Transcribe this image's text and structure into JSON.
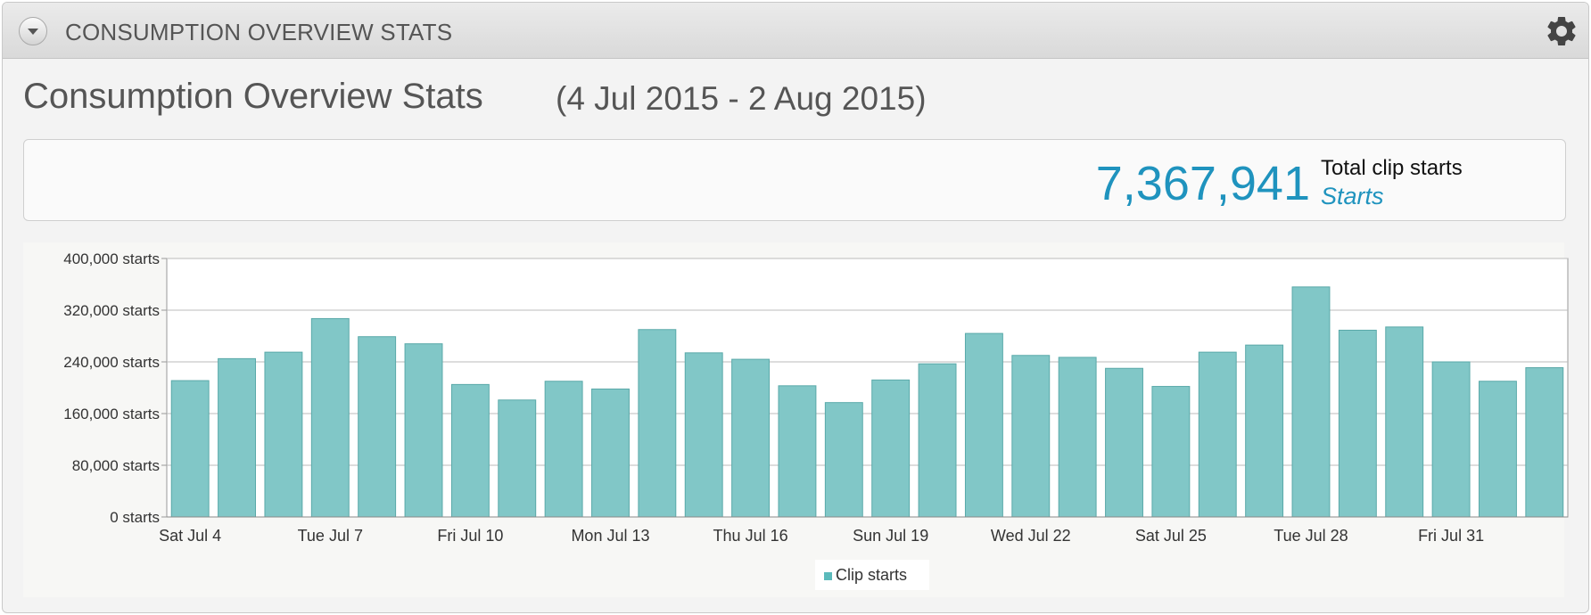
{
  "header": {
    "title": "CONSUMPTION OVERVIEW STATS"
  },
  "page": {
    "title": "Consumption Overview Stats",
    "date_range": "(4 Jul 2015 - 2 Aug 2015)"
  },
  "summary": {
    "value": "7,367,941",
    "label": "Total clip starts",
    "sublabel": "Starts"
  },
  "colors": {
    "bar": "#81c7c7",
    "bar_border": "#5aa9a9",
    "accent": "#1f93be"
  },
  "icons": {
    "collapse": "chevron-down-icon",
    "settings": "gear-icon"
  },
  "chart_data": {
    "type": "bar",
    "categories": [
      "Sat Jul 4",
      "Sun Jul 5",
      "Mon Jul 6",
      "Tue Jul 7",
      "Wed Jul 8",
      "Thu Jul 9",
      "Fri Jul 10",
      "Sat Jul 11",
      "Sun Jul 12",
      "Mon Jul 13",
      "Tue Jul 14",
      "Wed Jul 15",
      "Thu Jul 16",
      "Fri Jul 17",
      "Sat Jul 18",
      "Sun Jul 19",
      "Mon Jul 20",
      "Tue Jul 21",
      "Wed Jul 22",
      "Thu Jul 23",
      "Fri Jul 24",
      "Sat Jul 25",
      "Sun Jul 26",
      "Mon Jul 27",
      "Tue Jul 28",
      "Wed Jul 29",
      "Thu Jul 30",
      "Fri Jul 31",
      "Sat Aug 1",
      "Sun Aug 2"
    ],
    "x_tick_labels": [
      "Sat Jul 4",
      "Tue Jul 7",
      "Fri Jul 10",
      "Mon Jul 13",
      "Thu Jul 16",
      "Sun Jul 19",
      "Wed Jul 22",
      "Sat Jul 25",
      "Tue Jul 28",
      "Fri Jul 31"
    ],
    "x_tick_label_category_indices": [
      0,
      3,
      6,
      9,
      12,
      15,
      18,
      21,
      24,
      27
    ],
    "series": [
      {
        "name": "Clip starts",
        "values": [
          211000,
          245000,
          255000,
          307000,
          279000,
          268000,
          205000,
          181000,
          210000,
          198000,
          290000,
          254000,
          244000,
          203000,
          177000,
          212000,
          237000,
          284000,
          250000,
          247000,
          230000,
          202000,
          255000,
          266000,
          356000,
          289000,
          294000,
          240000,
          210000,
          231000
        ]
      }
    ],
    "y_tick_labels": [
      "0 starts",
      "80,000 starts",
      "160,000 starts",
      "240,000 starts",
      "320,000 starts",
      "400,000 starts"
    ],
    "ylim": [
      0,
      400000
    ],
    "grid": true,
    "legend": "bottom-center"
  }
}
